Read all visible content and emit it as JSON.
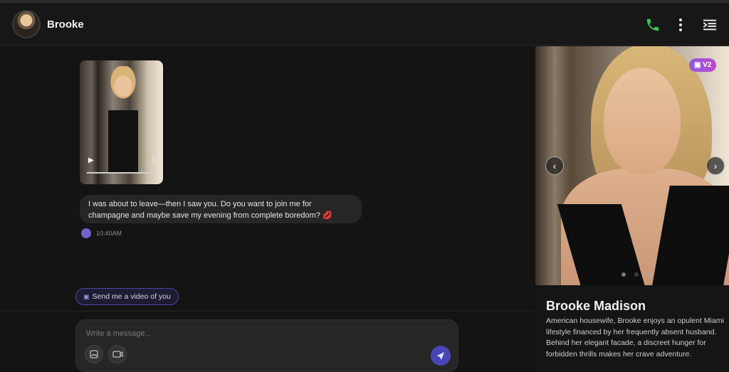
{
  "header": {
    "contact_name": "Brooke",
    "icons": [
      "phone-icon",
      "more-vertical-icon",
      "sidebar-toggle-icon"
    ],
    "phone_color": "#3fbf5a"
  },
  "chat": {
    "message_text": "I was about to leave—then I saw you. Do you want to join me for champagne and maybe save my evening from complete boredom? 💋",
    "timestamp": "10:40AM",
    "suggestion_chip": "Send me a video of you",
    "composer_placeholder": "Write a message..."
  },
  "profile": {
    "badge": "V2",
    "name": "Brooke Madison",
    "description": "American housewife, Brooke enjoys an opulent Miami lifestyle financed by her frequently absent husband. Behind her elegant facade, a discreet hunger for forbidden thrills makes her crave adventure.",
    "carousel": {
      "total": 3,
      "active_index": 1
    }
  },
  "colors": {
    "accent": "#4b44b8",
    "badge_gradient": [
      "#8d57e6",
      "#c04ac6"
    ]
  }
}
